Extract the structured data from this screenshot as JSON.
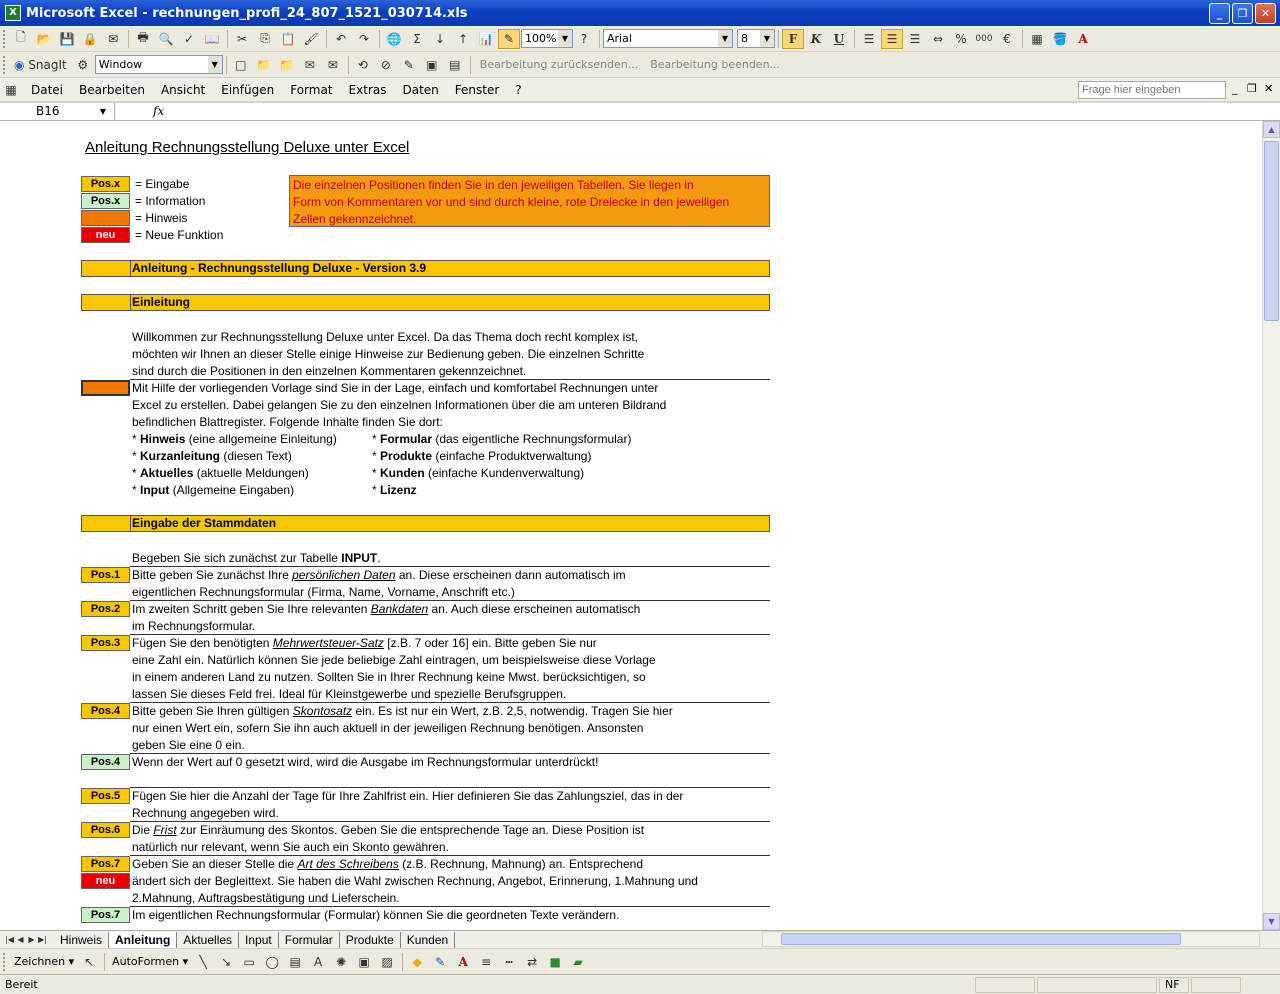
{
  "window": {
    "title": "Microsoft Excel - rechnungen_profi_24_807_1521_030714.xls"
  },
  "toolbar": {
    "zoom": "100%",
    "font": "Arial",
    "font_size": "8",
    "bold_label": "F",
    "italic_label": "K",
    "underline_label": "U",
    "percent_label": "%",
    "thousands_label": "000",
    "euro_label": "€",
    "font_color_label": "A"
  },
  "snagit": {
    "label": "SnagIt",
    "window_select": "Window",
    "review_send": "Bearbeitung zurücksenden...",
    "review_end": "Bearbeitung beenden..."
  },
  "menu": {
    "items": [
      "Datei",
      "Bearbeiten",
      "Ansicht",
      "Einfügen",
      "Format",
      "Extras",
      "Daten",
      "Fenster",
      "?"
    ],
    "help_placeholder": "Frage hier eingeben"
  },
  "formula": {
    "cell_ref": "B16",
    "fx": "fx",
    "value": ""
  },
  "sheet": {
    "title": "Anleitung Rechnungsstellung Deluxe unter Excel",
    "legend": [
      {
        "badge": "Pos.x",
        "color": "#f8c600",
        "text": "= Eingabe"
      },
      {
        "badge": "Pos.x",
        "color": "#c9f0c9",
        "text": "= Information"
      },
      {
        "badge": "",
        "color": "#f07800",
        "text": "= Hinweis"
      },
      {
        "badge": "neu",
        "color": "#e60000",
        "text": "= Neue Funktion"
      }
    ],
    "note_lines": [
      "Die einzelnen Positionen finden Sie in den jeweiligen Tabellen. Sie liegen in",
      "Form von Kommentaren vor und sind durch kleine, rote Dreiecke in den jeweiligen",
      "Zellen gekennzeichnet."
    ],
    "section1": "Anleitung - Rechnungsstellung Deluxe - Version 3.9",
    "section2": "Einleitung",
    "intro_lines": [
      "Willkommen zur Rechnungsstellung Deluxe unter Excel. Da das Thema doch recht komplex ist,",
      "möchten wir Ihnen an dieser Stelle einige Hinweise zur Bedienung geben. Die einzelnen Schritte",
      "sind durch die Positionen in den einzelnen Kommentaren gekennzeichnet."
    ],
    "help_lines": [
      "Mit Hilfe der vorliegenden Vorlage sind Sie in der Lage, einfach und komfortabel Rechnungen unter",
      "Excel zu erstellen. Dabei gelangen Sie zu den einzelnen Informationen über die am unteren Bildrand",
      "befindlichen Blattregister. Folgende Inhalte finden Sie dort:"
    ],
    "sheets_left": [
      {
        "name": "Hinweis",
        "desc": "(eine allgemeine Einleitung)"
      },
      {
        "name": "Kurzanleitung",
        "desc": "(diesen Text)"
      },
      {
        "name": "Aktuelles",
        "desc": "(aktuelle Meldungen)"
      },
      {
        "name": "Input",
        "desc": "(Allgemeine Eingaben)"
      }
    ],
    "sheets_right": [
      {
        "name": "Formular",
        "desc": "(das eigentliche Rechnungsformular)"
      },
      {
        "name": "Produkte",
        "desc": "(einfache Produktverwaltung)"
      },
      {
        "name": "Kunden",
        "desc": "(einfache Kundenverwaltung)"
      },
      {
        "name": "Lizenz",
        "desc": ""
      }
    ],
    "bullet": "* ",
    "section3": "Eingabe der Stammdaten",
    "stamm_intro_pre": "Begeben Sie sich zunächst zur Tabelle ",
    "stamm_intro_bold": "INPUT",
    "stamm_intro_post": ".",
    "pos1": {
      "badge": "Pos.1",
      "pre": "Bitte geben Sie zunächst Ihre ",
      "link": "persönlichen Daten",
      "post": " an. Diese erscheinen dann automatisch im",
      "line2": "eigentlichen Rechnungsformular (Firma, Name, Vorname, Anschrift etc.)"
    },
    "pos2": {
      "badge": "Pos.2",
      "pre": "Im zweiten Schritt geben Sie Ihre relevanten ",
      "link": "Bankdaten",
      "post": " an. Auch diese erscheinen automatisch",
      "line2": "im Rechnungsformular."
    },
    "pos3": {
      "badge": "Pos.3",
      "pre": "Fügen Sie den benötigten ",
      "link": "Mehrwertsteuer-Satz",
      "post": " [z.B. 7 oder 16] ein. Bitte geben Sie nur",
      "line2": "eine Zahl ein. Natürlich können Sie jede beliebige Zahl eintragen, um beispielsweise diese Vorlage",
      "line3": "in einem anderen Land zu nutzen. Sollten Sie in Ihrer Rechnung keine Mwst. berücksichtigen, so",
      "line4": "lassen Sie dieses Feld frei. Ideal für Kleinstgewerbe und spezielle Berufsgruppen."
    },
    "pos4": {
      "badge": "Pos.4",
      "pre": "Bitte geben Sie Ihren gültigen ",
      "link": "Skontosatz",
      "post": " ein. Es ist nur ein Wert, z.B. 2,5, notwendig. Tragen Sie hier",
      "line2": "nur einen Wert ein, sofern Sie ihn auch aktuell in der jeweiligen Rechnung benötigen. Ansonsten",
      "line3": "geben Sie eine 0 ein."
    },
    "pos4b": {
      "badge": "Pos.4",
      "text": "Wenn der Wert auf 0 gesetzt wird, wird die Ausgabe im Rechnungsformular unterdrückt!"
    },
    "pos5": {
      "badge": "Pos.5",
      "text": "Fügen Sie hier die Anzahl der Tage für Ihre Zahlfrist ein. Hier definieren Sie das Zahlungsziel, das in der",
      "line2": "Rechnung angegeben wird."
    },
    "pos6": {
      "badge": "Pos.6",
      "pre": "Die ",
      "link": "Frist",
      "post": " zur Einräumung des Skontos. Geben Sie die entsprechende Tage an. Diese Position ist",
      "line2": "natürlich nur relevant, wenn Sie auch ein Skonto gewähren."
    },
    "pos7": {
      "badge": "Pos.7",
      "badge2": "neu",
      "pre": "Geben Sie an dieser Stelle die ",
      "link": "Art des Schreibens",
      "post": " (z.B. Rechnung, Mahnung) an. Entsprechend",
      "line2": "ändert sich der Begleittext. Sie haben die Wahl zwischen Rechnung, Angebot, Erinnerung, 1.Mahnung und",
      "line3": "2.Mahnung, Auftragsbestätigung und Lieferschein."
    },
    "pos7b": {
      "badge": "Pos.7",
      "text": "Im eigentlichen Rechnungsformular (Formular) können Sie die geordneten Texte verändern."
    }
  },
  "tabs": [
    "Hinweis",
    "Anleitung",
    "Aktuelles",
    "Input",
    "Formular",
    "Produkte",
    "Kunden"
  ],
  "active_tab": "Anleitung",
  "drawing": {
    "draw_label": "Zeichnen",
    "autoshapes_label": "AutoFormen"
  },
  "status": {
    "left": "Bereit",
    "nf": "NF"
  }
}
